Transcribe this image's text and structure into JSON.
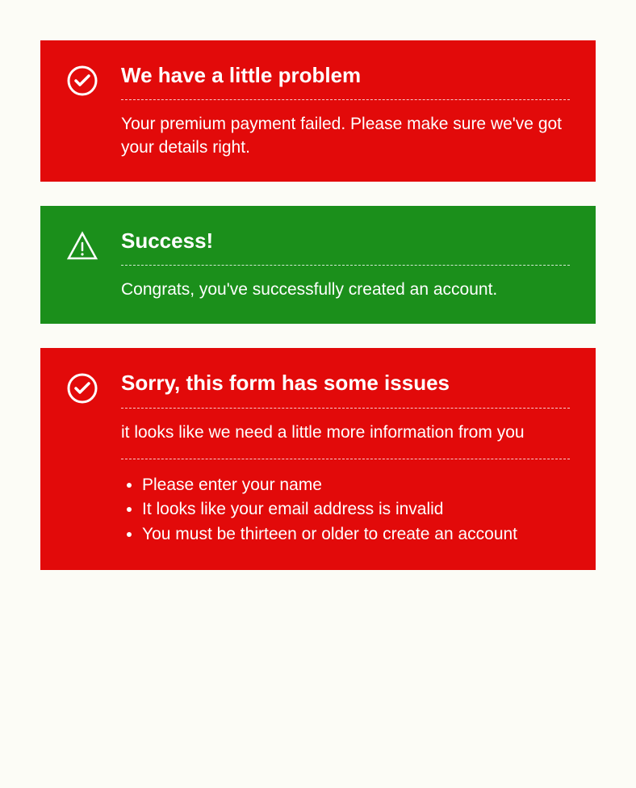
{
  "colors": {
    "error_bg": "#e20a0a",
    "success_bg": "#1b8f1b",
    "text": "#ffffff"
  },
  "alerts": [
    {
      "type": "error",
      "icon": "check-circle",
      "title": "We have a little problem",
      "message": "Your premium payment failed. Please make sure we've got your details right."
    },
    {
      "type": "success",
      "icon": "warning-triangle",
      "title": "Success!",
      "message": "Congrats, you've successfully created an account."
    },
    {
      "type": "error",
      "icon": "check-circle",
      "title": "Sorry, this form has some issues",
      "message": "it looks like we need a little more information from you",
      "issues": [
        "Please enter your name",
        "It looks like your email address is invalid",
        "You must be thirteen or older to create an account"
      ]
    }
  ]
}
